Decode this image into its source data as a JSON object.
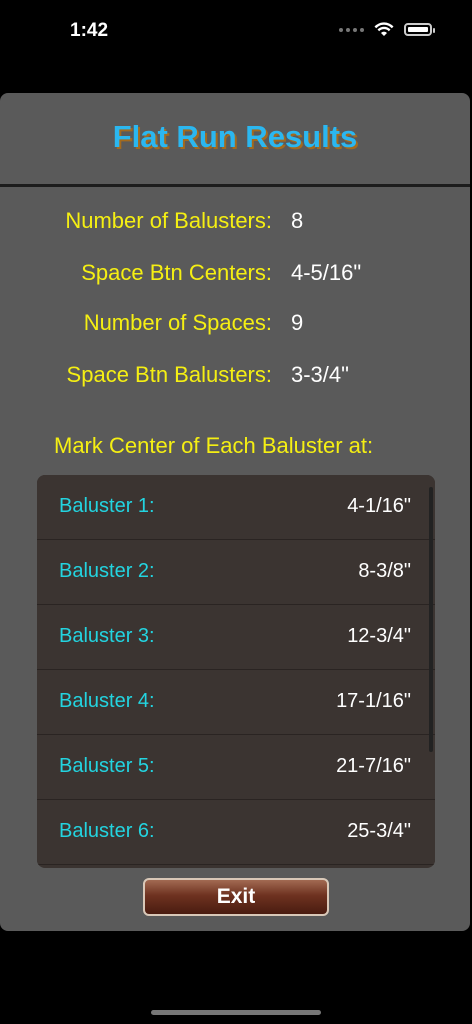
{
  "status_bar": {
    "time": "1:42",
    "icons": [
      "cellular-dots-icon",
      "wifi-icon",
      "battery-icon"
    ]
  },
  "header": {
    "title": "Flat Run Results"
  },
  "stats": [
    {
      "label": "Number of Balusters:",
      "value": "8"
    },
    {
      "label": "Space Btn Centers:",
      "value": "4-5/16\""
    },
    {
      "label": "Number of Spaces:",
      "value": "9"
    },
    {
      "label": "Space Btn Balusters:",
      "value": "3-3/4\""
    }
  ],
  "mark_heading": "Mark Center of Each Baluster at:",
  "balusters": [
    {
      "label": "Baluster 1:",
      "value": "4-1/16\""
    },
    {
      "label": "Baluster 2:",
      "value": "8-3/8\""
    },
    {
      "label": "Baluster 3:",
      "value": "12-3/4\""
    },
    {
      "label": "Baluster 4:",
      "value": "17-1/16\""
    },
    {
      "label": "Baluster 5:",
      "value": "21-7/16\""
    },
    {
      "label": "Baluster 6:",
      "value": "25-3/4\""
    }
  ],
  "exit_label": "Exit",
  "colors": {
    "title": "#2bb7f0",
    "label_yellow": "#f5ef13",
    "row_label_cyan": "#23d4e0",
    "panel_bg": "#5a5a5a",
    "list_bg": "#3b3431"
  }
}
